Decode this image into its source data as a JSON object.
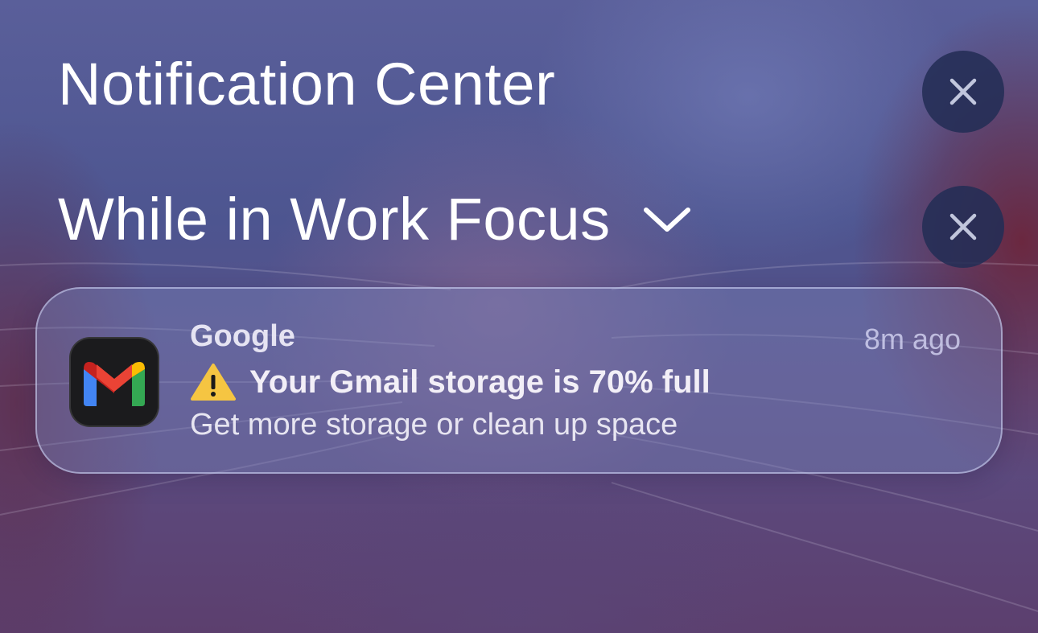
{
  "notification_center": {
    "title": "Notification Center",
    "close_label": "Clear all"
  },
  "focus_group": {
    "title": "While in Work Focus",
    "expand_icon": "chevron-down-icon",
    "close_icon": "close-icon"
  },
  "notification": {
    "app_icon": "gmail-icon",
    "app_name": "Google",
    "time": "8m ago",
    "warning_icon": "warning-icon",
    "title": "Your Gmail storage is 70% full",
    "body": "Get more storage or clean up space"
  },
  "colors": {
    "gmail_red": "#EA4335",
    "gmail_blue": "#4285F4",
    "gmail_green": "#34A853",
    "gmail_yellow": "#FBBC04",
    "warning_yellow": "#F5C542"
  }
}
